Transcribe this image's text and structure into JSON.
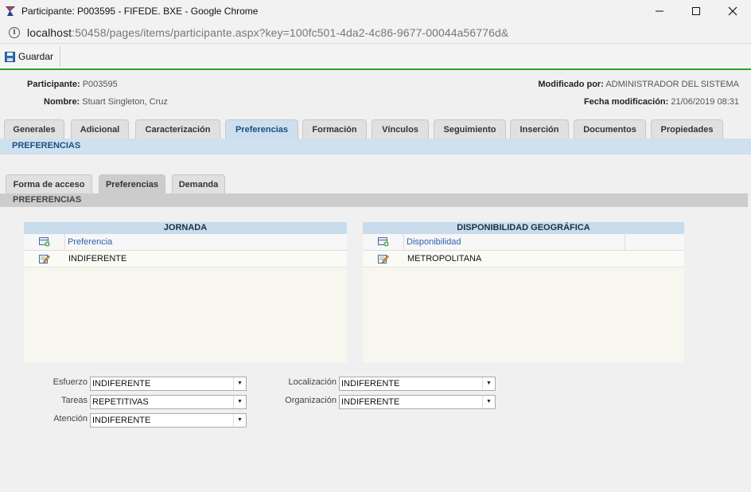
{
  "window": {
    "title": "Participante: P003595 - FIFEDE. BXE - Google Chrome",
    "url_host": "localhost",
    "url_rest": ":50458/pages/items/participante.aspx?key=100fc501-4da2-4c86-9677-00044a56776d&"
  },
  "toolbar": {
    "save_label": "Guardar"
  },
  "header": {
    "participante_label": "Participante:",
    "participante_value": "P003595",
    "nombre_label": "Nombre:",
    "nombre_value": "Stuart Singleton, Cruz",
    "modificado_label": "Modificado por:",
    "modificado_value": "ADMINISTRADOR DEL SISTEMA",
    "fecha_label": "Fecha modificación:",
    "fecha_value": "21/06/2019 08:31"
  },
  "tabs": [
    "Generales",
    "Adicional",
    "Caracterización",
    "Preferencias",
    "Formación",
    "Vínculos",
    "Seguimiento",
    "Inserción",
    "Documentos",
    "Propiedades"
  ],
  "active_tab": "Preferencias",
  "section_title": "PREFERENCIAS",
  "subtabs": [
    "Forma de acceso",
    "Preferencias",
    "Demanda"
  ],
  "active_subtab": "Preferencias",
  "subsection_title": "PREFERENCIAS",
  "grids": {
    "jornada": {
      "title": "JORNADA",
      "column": "Preferencia",
      "rows": [
        "INDIFERENTE"
      ]
    },
    "disponibilidad": {
      "title": "DISPONIBILIDAD GEOGRÁFICA",
      "column": "Disponibilidad",
      "rows": [
        "METROPOLITANA"
      ]
    }
  },
  "fields": {
    "esfuerzo": {
      "label": "Esfuerzo",
      "value": "INDIFERENTE"
    },
    "tareas": {
      "label": "Tareas",
      "value": "REPETITIVAS"
    },
    "atencion": {
      "label": "Atención",
      "value": "INDIFERENTE"
    },
    "localizacion": {
      "label": "Localización",
      "value": "INDIFERENTE"
    },
    "organizacion": {
      "label": "Organización",
      "value": "INDIFERENTE"
    }
  },
  "colors": {
    "accent_green": "#2aa52a",
    "section_blue": "#cfe0ef",
    "link_blue": "#2a62b0"
  }
}
